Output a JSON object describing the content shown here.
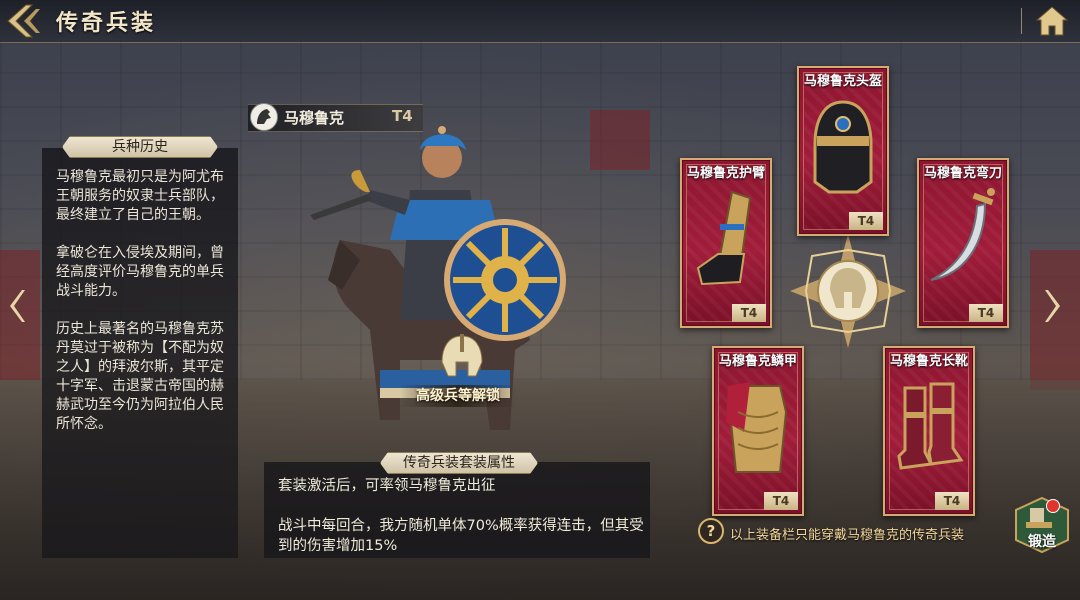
{
  "header": {
    "title": "传奇兵装",
    "back_icon": "back-arrow-icon",
    "home_icon": "home-icon"
  },
  "history": {
    "tab_label": "兵种历史",
    "paragraphs": [
      "马穆鲁克最初只是为阿尤布王朝服务的奴隶士兵部队，最终建立了自己的王朝。",
      "拿破仑在入侵埃及期间，曾经高度评价马穆鲁克的单兵战斗能力。",
      "历史上最著名的马穆鲁克苏丹莫过于被称为【不配为奴之人】的拜波尔斯，其平定十字军、击退蒙古帝国的赫赫武功至今仍为阿拉伯人民所怀念。"
    ]
  },
  "unit": {
    "name": "马穆鲁克",
    "tier": "T4",
    "unlock_label": "高级兵等解锁"
  },
  "set_bonus": {
    "tab_label": "传奇兵装套装属性",
    "lines": [
      "套装激活后，可率领马穆鲁克出征",
      "战斗中每回合，我方随机单体70%概率获得连击，但其受到的伤害增加15%"
    ]
  },
  "equipment": [
    {
      "key": "helmet",
      "label": "马穆鲁克头盔",
      "tier": "T4",
      "icon": "helmet-icon"
    },
    {
      "key": "bracer",
      "label": "马穆鲁克护臂",
      "tier": "T4",
      "icon": "bracer-icon"
    },
    {
      "key": "scimitar",
      "label": "马穆鲁克弯刀",
      "tier": "T4",
      "icon": "scimitar-icon"
    },
    {
      "key": "armor",
      "label": "马穆鲁克鳞甲",
      "tier": "T4",
      "icon": "scale-armor-icon"
    },
    {
      "key": "boots",
      "label": "马穆鲁克长靴",
      "tier": "T4",
      "icon": "boots-icon"
    }
  ],
  "hint": {
    "icon": "question-icon",
    "text": "以上装备栏只能穿戴马穆鲁克的传奇兵装"
  },
  "forge": {
    "label": "锻造",
    "icon": "anvil-icon",
    "has_notification": true
  },
  "colors": {
    "accent_gold": "#d6aa72",
    "card_red": "#a11d3a",
    "notification_red": "#e0342c"
  }
}
